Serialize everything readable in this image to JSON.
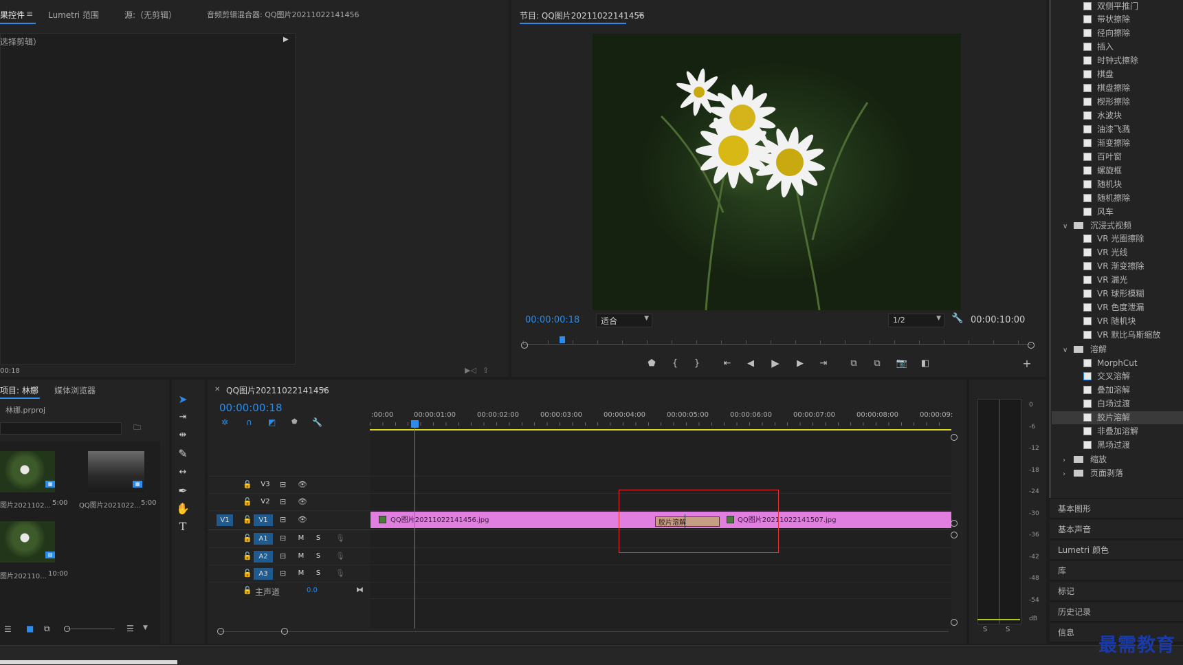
{
  "effect_controls": {
    "tabs": [
      "果控件",
      "Lumetri 范围",
      "源:（无剪辑）",
      "音频剪辑混合器: QQ图片20211022141456"
    ],
    "no_clip": "选择剪辑）",
    "time": "00:18"
  },
  "program_monitor": {
    "title": "节目: QQ图片20211022141456",
    "current_time": "00:00:00:18",
    "fit": "适合",
    "resolution": "1/2",
    "duration": "00:00:10:00"
  },
  "project": {
    "tabs": [
      "项目: 林娜",
      "媒体浏览器"
    ],
    "file": "林娜.prproj",
    "items": [
      {
        "name": "图片2021102...",
        "dur": "5:00"
      },
      {
        "name": "QQ图片2021022...",
        "dur": "5:00"
      },
      {
        "name": "图片202110...",
        "dur": "10:00"
      }
    ]
  },
  "timeline": {
    "tab": "QQ图片20211022141456",
    "timecode": "00:00:00:18",
    "ruler": [
      ":00:00",
      "00:00:01:00",
      "00:00:02:00",
      "00:00:03:00",
      "00:00:04:00",
      "00:00:05:00",
      "00:00:06:00",
      "00:00:07:00",
      "00:00:08:00",
      "00:00:09:"
    ],
    "tracks": {
      "v3": "V3",
      "v2": "V2",
      "v1": "V1",
      "v1_src": "V1",
      "a1": "A1",
      "a2": "A2",
      "a3": "A3",
      "m": "M",
      "s": "S",
      "master": "主声道",
      "master_val": "0.0"
    },
    "clip1": "QQ图片20211022141456.jpg",
    "clip2": "QQ图片20211022141507.jpg",
    "transition": "胶片溶解"
  },
  "meter": {
    "scale": [
      "0",
      "-6",
      "-12",
      "-18",
      "-24",
      "-30",
      "-36",
      "-42",
      "-48",
      "-54",
      "dB"
    ],
    "solo": "S"
  },
  "effects": {
    "items_top": [
      "双侧平推门",
      "带状擦除",
      "径向擦除",
      "插入",
      "时钟式擦除",
      "棋盘",
      "棋盘擦除",
      "楔形擦除",
      "水波块",
      "油漆飞溅",
      "渐变擦除",
      "百叶窗",
      "螺旋框",
      "随机块",
      "随机擦除",
      "风车"
    ],
    "folder_vr": "沉浸式视频",
    "items_vr": [
      "VR 光圈擦除",
      "VR 光线",
      "VR 渐变擦除",
      "VR 漏光",
      "VR 球形模糊",
      "VR 色度泄漏",
      "VR 随机块",
      "VR 默比乌斯缩放"
    ],
    "folder_dissolve": "溶解",
    "items_dissolve": [
      "MorphCut",
      "交叉溶解",
      "叠加溶解",
      "白场过渡",
      "胶片溶解",
      "非叠加溶解",
      "黑场过渡"
    ],
    "folder_zoom": "缩放",
    "folder_page": "页面剥落"
  },
  "side_panels": [
    "基本图形",
    "基本声音",
    "Lumetri 颜色",
    "库",
    "标记",
    "历史记录",
    "信息"
  ],
  "watermark": "最需教育",
  "colors": {
    "accent": "#2d8ceb",
    "clip": "#e17fe0",
    "selection": "#e83030",
    "transition": "#c69d85"
  }
}
